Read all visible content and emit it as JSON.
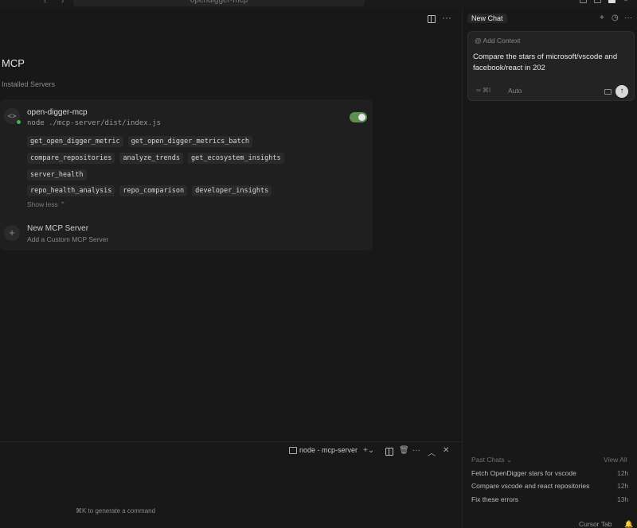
{
  "titlebar": {
    "search_text": "opendigger-mcp"
  },
  "page": {
    "title": "MCP",
    "installed_label": "Installed Servers"
  },
  "server": {
    "name": "open-digger-mcp",
    "command": "node ./mcp-server/dist/index.js",
    "enabled": true,
    "tools": [
      "get_open_digger_metric",
      "get_open_digger_metrics_batch",
      "compare_repositories",
      "analyze_trends",
      "get_ecosystem_insights",
      "server_health"
    ],
    "prompts": [
      "repo_health_analysis",
      "repo_comparison",
      "developer_insights"
    ],
    "show_less": "Show less"
  },
  "new_server": {
    "title": "New MCP Server",
    "subtitle": "Add a Custom MCP Server"
  },
  "terminal": {
    "tab_label": "node - mcp-server",
    "hint": "⌘K to generate a command"
  },
  "chat": {
    "tab_label": "New Chat",
    "add_context": "Add Context",
    "prompt": "Compare the stars of microsoft/vscode and facebook/react in 202",
    "mode": "∞ ⌘I",
    "model": "Auto",
    "past_header": "Past Chats",
    "view_all": "View All",
    "past_chats": [
      {
        "title": "Fetch OpenDigger stars for vscode",
        "time": "12h"
      },
      {
        "title": "Compare vscode and react repositories",
        "time": "12h"
      },
      {
        "title": "Fix these errors",
        "time": "13h"
      }
    ]
  },
  "statusbar": {
    "cursor_tab": "Cursor Tab"
  }
}
